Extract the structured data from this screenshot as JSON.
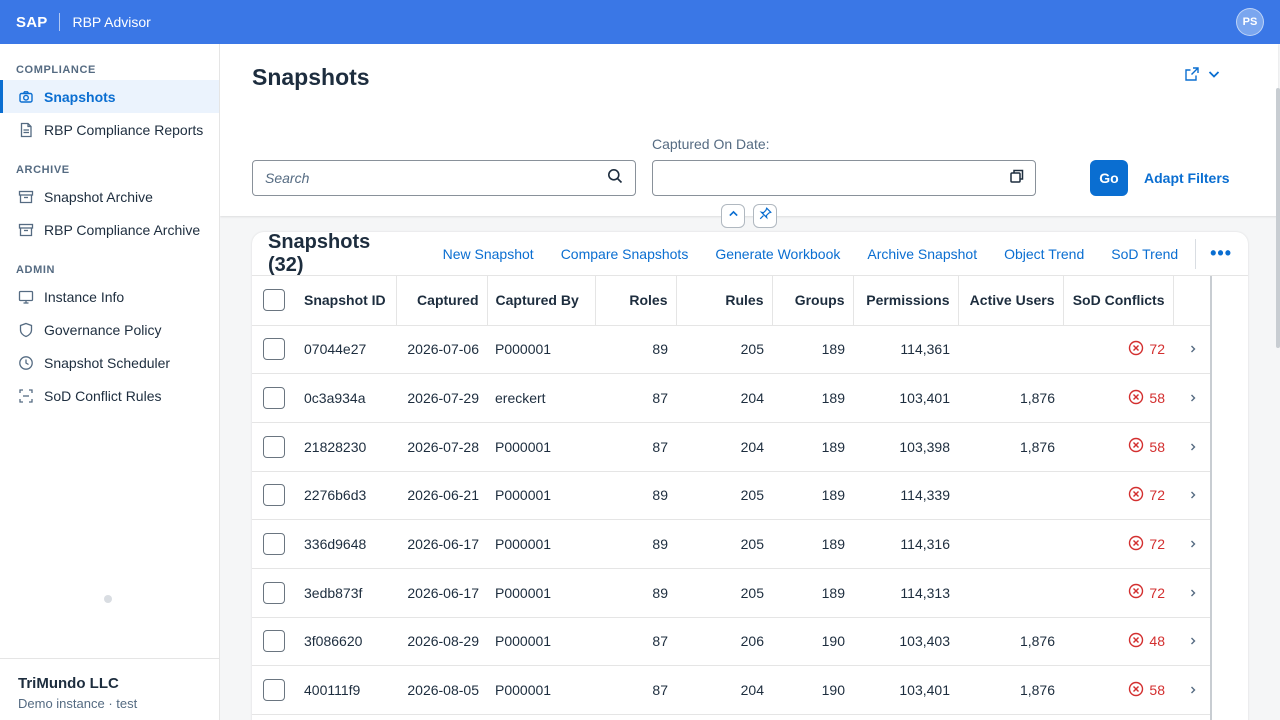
{
  "shell": {
    "logo": "SAP",
    "app_name": "RBP Advisor",
    "avatar": "PS"
  },
  "sidebar": {
    "sections": [
      {
        "title": "COMPLIANCE",
        "items": [
          {
            "label": "Snapshots",
            "icon": "camera-icon",
            "active": true
          },
          {
            "label": "RBP Compliance Reports",
            "icon": "document-icon"
          }
        ]
      },
      {
        "title": "ARCHIVE",
        "items": [
          {
            "label": "Snapshot Archive",
            "icon": "archive-icon"
          },
          {
            "label": "RBP Compliance Archive",
            "icon": "archive-icon"
          }
        ]
      },
      {
        "title": "ADMIN",
        "items": [
          {
            "label": "Instance Info",
            "icon": "monitor-icon"
          },
          {
            "label": "Governance Policy",
            "icon": "shield-icon"
          },
          {
            "label": "Snapshot Scheduler",
            "icon": "clock-icon"
          },
          {
            "label": "SoD Conflict Rules",
            "icon": "scan-icon"
          }
        ]
      }
    ],
    "company": {
      "name": "TriMundo LLC",
      "subtitle": "Demo instance · test"
    }
  },
  "header": {
    "title": "Snapshots",
    "search_placeholder": "Search",
    "date_label": "Captured On Date:",
    "go_label": "Go",
    "adapt_filters_label": "Adapt Filters"
  },
  "table": {
    "title": "Snapshots (32)",
    "actions": [
      "New Snapshot",
      "Compare Snapshots",
      "Generate Workbook",
      "Archive Snapshot",
      "Object Trend",
      "SoD Trend"
    ],
    "columns": [
      "Snapshot ID",
      "Captured",
      "Captured By",
      "Roles",
      "Rules",
      "Groups",
      "Permissions",
      "Active Users",
      "SoD Conflicts"
    ],
    "rows": [
      {
        "id": "07044e27",
        "captured": "2026-07-06",
        "by": "P000001",
        "roles": "89",
        "rules": "205",
        "groups": "189",
        "permissions": "114,361",
        "active_users": "",
        "conflicts": "72"
      },
      {
        "id": "0c3a934a",
        "captured": "2026-07-29",
        "by": "ereckert",
        "roles": "87",
        "rules": "204",
        "groups": "189",
        "permissions": "103,401",
        "active_users": "1,876",
        "conflicts": "58"
      },
      {
        "id": "21828230",
        "captured": "2026-07-28",
        "by": "P000001",
        "roles": "87",
        "rules": "204",
        "groups": "189",
        "permissions": "103,398",
        "active_users": "1,876",
        "conflicts": "58"
      },
      {
        "id": "2276b6d3",
        "captured": "2026-06-21",
        "by": "P000001",
        "roles": "89",
        "rules": "205",
        "groups": "189",
        "permissions": "114,339",
        "active_users": "",
        "conflicts": "72"
      },
      {
        "id": "336d9648",
        "captured": "2026-06-17",
        "by": "P000001",
        "roles": "89",
        "rules": "205",
        "groups": "189",
        "permissions": "114,316",
        "active_users": "",
        "conflicts": "72"
      },
      {
        "id": "3edb873f",
        "captured": "2026-06-17",
        "by": "P000001",
        "roles": "89",
        "rules": "205",
        "groups": "189",
        "permissions": "114,313",
        "active_users": "",
        "conflicts": "72"
      },
      {
        "id": "3f086620",
        "captured": "2026-08-29",
        "by": "P000001",
        "roles": "87",
        "rules": "206",
        "groups": "190",
        "permissions": "103,403",
        "active_users": "1,876",
        "conflicts": "48"
      },
      {
        "id": "400111f9",
        "captured": "2026-08-05",
        "by": "P000001",
        "roles": "87",
        "rules": "204",
        "groups": "190",
        "permissions": "103,401",
        "active_users": "1,876",
        "conflicts": "58"
      }
    ]
  },
  "colors": {
    "shell": "#3a77e6",
    "accent": "#0a6ed1",
    "error": "#d32f2f"
  }
}
